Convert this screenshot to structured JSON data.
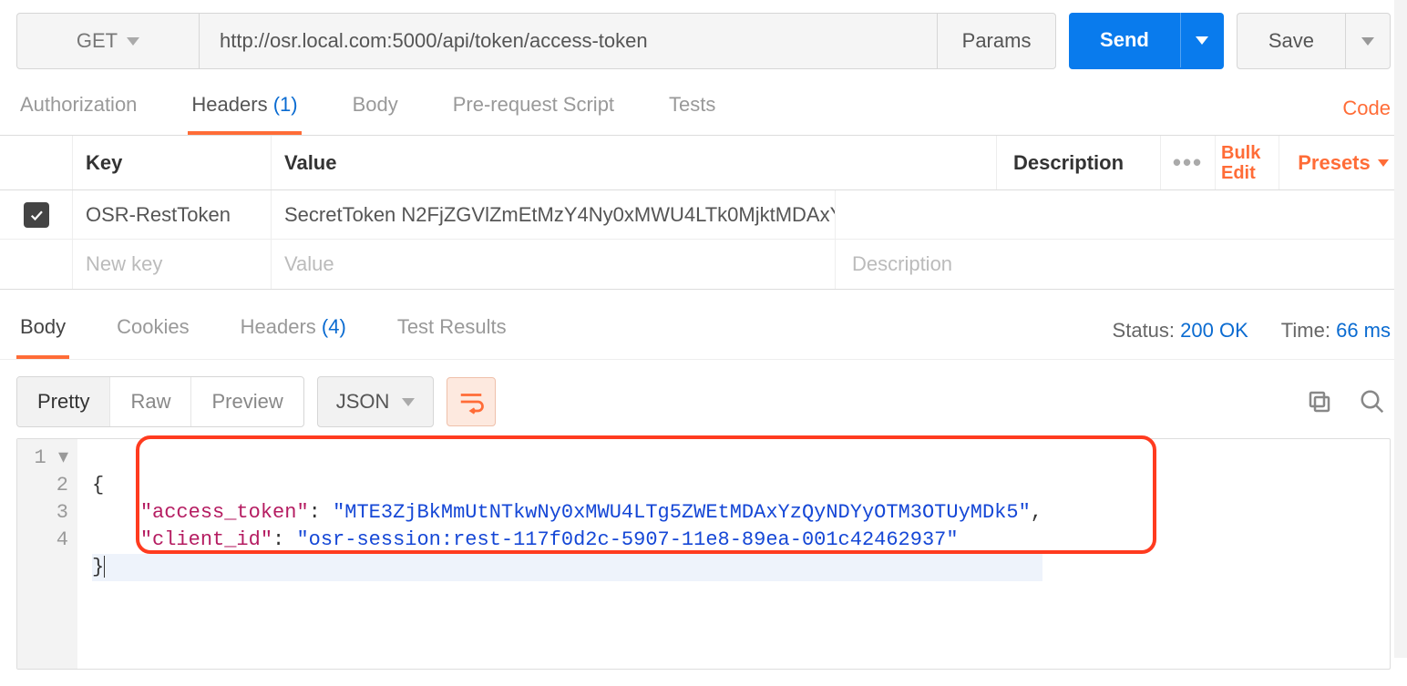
{
  "request": {
    "method": "GET",
    "url": "http://osr.local.com:5000/api/token/access-token",
    "params_label": "Params",
    "send_label": "Send",
    "save_label": "Save"
  },
  "req_tabs": {
    "authorization": "Authorization",
    "headers_label": "Headers",
    "headers_count": "(1)",
    "body": "Body",
    "prerequest": "Pre-request Script",
    "tests": "Tests",
    "code_link": "Code"
  },
  "headers_table": {
    "columns": {
      "key": "Key",
      "value": "Value",
      "description": "Description"
    },
    "bulk_edit": "Bulk Edit",
    "presets": "Presets",
    "rows": [
      {
        "enabled": true,
        "key": "OSR-RestToken",
        "value": "SecretToken N2FjZGVlZmEtMzY4Ny0xMWU4LTk0MjktMDAxY...",
        "description": ""
      }
    ],
    "placeholder": {
      "key": "New key",
      "value": "Value",
      "description": "Description"
    }
  },
  "response": {
    "tabs": {
      "body": "Body",
      "cookies": "Cookies",
      "headers_label": "Headers",
      "headers_count": "(4)",
      "test_results": "Test Results"
    },
    "status_label": "Status:",
    "status_value": "200 OK",
    "time_label": "Time:",
    "time_value": "66 ms"
  },
  "view": {
    "pretty": "Pretty",
    "raw": "Raw",
    "preview": "Preview",
    "format": "JSON"
  },
  "body_json": {
    "line1_num": "1",
    "line2_num": "2",
    "line3_num": "3",
    "line4_num": "4",
    "open_brace": "{",
    "close_brace": "}",
    "k1": "\"access_token\"",
    "v1": "\"MTE3ZjBkMmUtNTkwNy0xMWU4LTg5ZWEtMDAxYzQyNDYyOTM3OTUyMDk5\"",
    "k2": "\"client_id\"",
    "v2": "\"osr-session:rest-117f0d2c-5907-11e8-89ea-001c42462937\"",
    "colon": ":",
    "comma": ","
  }
}
